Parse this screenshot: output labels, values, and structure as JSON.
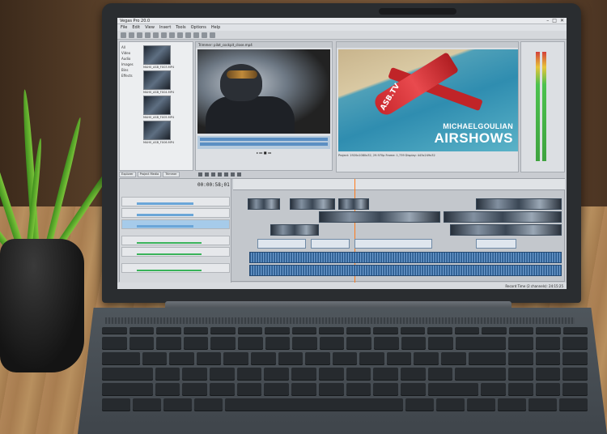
{
  "app": {
    "window_title": "Vegas Pro 20.0",
    "menu": [
      "File",
      "Edit",
      "View",
      "Insert",
      "Tools",
      "Options",
      "Help"
    ],
    "trimmer_header": "Trimmer: pilot_cockpit_close.mp4",
    "timecode": "00:00:58;01",
    "status_right": "Record Time (2 channels): 24:15:25"
  },
  "explorer": {
    "tree": [
      "All",
      "Video",
      "Audio",
      "Images",
      "Bins",
      "Effects"
    ],
    "thumbs": [
      "MAH0_ASB_FX03.MP4",
      "MAH0_ASB_FX04.MP4",
      "MAH0_ASB_FX05.MP4",
      "MAH0_ASB_FX06.MP4"
    ]
  },
  "tabs": [
    "Explorer",
    "Project Media",
    "Trimmer"
  ],
  "preview": {
    "plane_text": "ASB.TV",
    "caption_line1": "MICHAELGOULIAN",
    "caption_line2": "AIRSHOWS",
    "info": "Project: 1920x1080x32, 29.970p   Frame: 1,739   Display: 443x249x32"
  },
  "track_headers": [
    "Video 1",
    "Video 2",
    "Video 3",
    "Audio 1",
    "Audio 2",
    "Audio 3"
  ],
  "colors": {
    "accent_blue": "#6aa6d8",
    "playhead": "#ff7a1a",
    "plane_red": "#c9282d"
  }
}
